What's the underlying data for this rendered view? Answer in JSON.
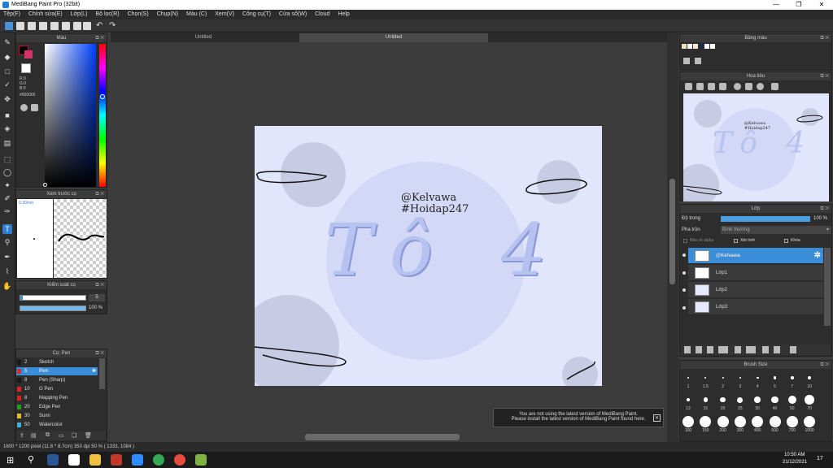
{
  "window": {
    "title": "MediBang Paint Pro (32bit)",
    "min": "—",
    "max": "❐",
    "close": "✕"
  },
  "menu": [
    "Tệp(F)",
    "Chỉnh sửa(E)",
    "Lớp(L)",
    "Bộ lọc(R)",
    "Chọn(S)",
    "Chụp(N)",
    "Màu (C)",
    "Xem(V)",
    "Công cụ(T)",
    "Cửa sổ(W)",
    "Cloud",
    "Help"
  ],
  "tabs": {
    "tab1": "Untitled",
    "tab2": "Untitled"
  },
  "color_panel": {
    "title": "Màu",
    "r": "R:0",
    "g": "G:0",
    "b": "B:0",
    "hex": "#000000"
  },
  "brush_preview": {
    "title": "Xem trước cọ",
    "size": "0.30mm"
  },
  "brush_control": {
    "title": "Kiểm soát cọ",
    "size_value": "5",
    "opacity_value": "100 %"
  },
  "brush_list": {
    "title": "Cọ: Pen",
    "items": [
      {
        "num": "2",
        "name": "Sketch",
        "color": "#1a1a1a"
      },
      {
        "num": "5",
        "name": "Pen",
        "color": "#d03030",
        "selected": true
      },
      {
        "num": "8",
        "name": "Pen (Sharp)",
        "color": "#1a1a1a"
      },
      {
        "num": "10",
        "name": "G Pen",
        "color": "#e02020"
      },
      {
        "num": "8",
        "name": "Mapping Pen",
        "color": "#e02020"
      },
      {
        "num": "20",
        "name": "Edge Pen",
        "color": "#20a020"
      },
      {
        "num": "30",
        "name": "Sumi",
        "color": "#e0c020"
      },
      {
        "num": "50",
        "name": "Watercolor",
        "color": "#40b0e0"
      }
    ]
  },
  "artwork": {
    "handle": "@Kelvawa",
    "tag": "#Hoidap247",
    "title": "Tô 4"
  },
  "palette_panel": {
    "title": "Bảng màu",
    "swatches": [
      "#f0e0c0",
      "#ffffff",
      "#ffe8d0",
      "#1a2a4a",
      "#ffffff",
      "#ffffff"
    ]
  },
  "navigator": {
    "title": "Hoa tiêu",
    "handle": "@Kelvawa",
    "tag": "#Hoidap247"
  },
  "layer_panel": {
    "title": "Lớp",
    "opacity_label": "Độ trong",
    "opacity_value": "100 %",
    "blend_label": "Pha trộn",
    "blend_value": "Bình thường",
    "protect_alpha": "Bảo vệ alpha",
    "clip": "Xén bớt",
    "lock": "Khóa",
    "layers": [
      "@Kelvawa",
      "Lớp1",
      "Lớp2",
      "Lớp3"
    ]
  },
  "brush_size": {
    "title": "Brush Size",
    "sizes": [
      "1",
      "1.5",
      "2",
      "3",
      "4",
      "5",
      "7",
      "10",
      "12",
      "15",
      "20",
      "25",
      "30",
      "40",
      "50",
      "70",
      "100",
      "150",
      "200",
      "300",
      "400",
      "500",
      "700",
      "1000"
    ]
  },
  "notice": {
    "line1": "You are not using the latest version of MediBang Paint.",
    "line2": "Please install the latest version of MediBang Paint found here."
  },
  "status": {
    "text": "1600 * 1200 pixel  (11.6 * 8.7cm)  350 dpi  50 %  ( 1333, 1084 )"
  },
  "taskbar": {
    "time": "10:50 AM",
    "date": "21/12/2021",
    "notif": "17"
  }
}
